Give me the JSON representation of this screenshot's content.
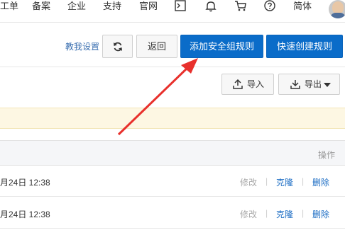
{
  "topnav": {
    "items": [
      "工单",
      "备案",
      "企业",
      "支持",
      "官网"
    ],
    "lang": "简体",
    "icons": [
      "terminal-icon",
      "bell-icon",
      "cart-icon",
      "help-icon"
    ]
  },
  "toolbar": {
    "teach_setting": "教我设置",
    "back": "返回",
    "add_rule": "添加安全组规则",
    "quick_create": "快速创建规则"
  },
  "actions": {
    "import": "导入",
    "export": "导出"
  },
  "table": {
    "op_header": "操作",
    "rows": [
      {
        "time": "月24日 12:38",
        "edit": "修改",
        "clone": "克隆",
        "delete": "删除"
      },
      {
        "time": "月24日 12:38",
        "edit": "修改",
        "clone": "克隆",
        "delete": "删除"
      }
    ]
  },
  "colors": {
    "primary": "#0a6cc9",
    "link": "#1c6dc4",
    "notice_bg": "#fdf7e3",
    "arrow": "#e8302c"
  }
}
